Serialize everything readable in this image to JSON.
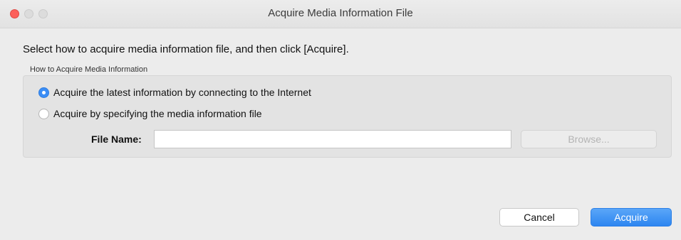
{
  "window": {
    "title": "Acquire Media Information File"
  },
  "dialog": {
    "instruction": "Select how to acquire media information file, and then click [Acquire].",
    "group_label": "How to Acquire Media Information",
    "options": [
      {
        "label": "Acquire the latest information by connecting to the Internet",
        "selected": true
      },
      {
        "label": "Acquire by specifying the media information file",
        "selected": false
      }
    ],
    "file_name": {
      "label": "File Name:",
      "value": "",
      "placeholder": ""
    },
    "browse_label": "Browse...",
    "browse_enabled": false
  },
  "footer": {
    "cancel_label": "Cancel",
    "acquire_label": "Acquire"
  },
  "colors": {
    "accent": "#3b8df5",
    "close_button": "#fc605b",
    "background": "#ececec"
  }
}
